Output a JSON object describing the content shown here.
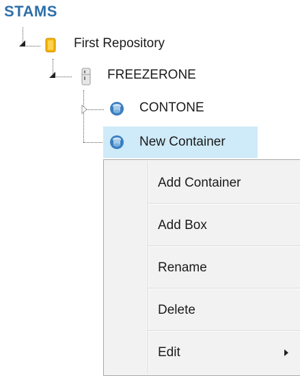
{
  "app": {
    "title": "STAMS"
  },
  "tree": {
    "repository": {
      "label": "First Repository",
      "icon": "repository-icon"
    },
    "freezer": {
      "label": "FREEZERONE",
      "icon": "freezer-icon"
    },
    "containers": [
      {
        "label": "CONTONE",
        "icon": "container-icon",
        "expandable": true
      },
      {
        "label": "New Container",
        "icon": "container-icon",
        "selected": true
      }
    ]
  },
  "context_menu": {
    "items": [
      {
        "label": "Add Container"
      },
      {
        "label": "Add Box"
      },
      {
        "label": "Rename"
      },
      {
        "label": "Delete"
      },
      {
        "label": "Edit",
        "has_submenu": true
      }
    ]
  },
  "colors": {
    "title": "#2e6fa8",
    "selection": "#cfeaf8",
    "repository_icon": "#f5b400",
    "container_icon": "#3a7fc1"
  }
}
